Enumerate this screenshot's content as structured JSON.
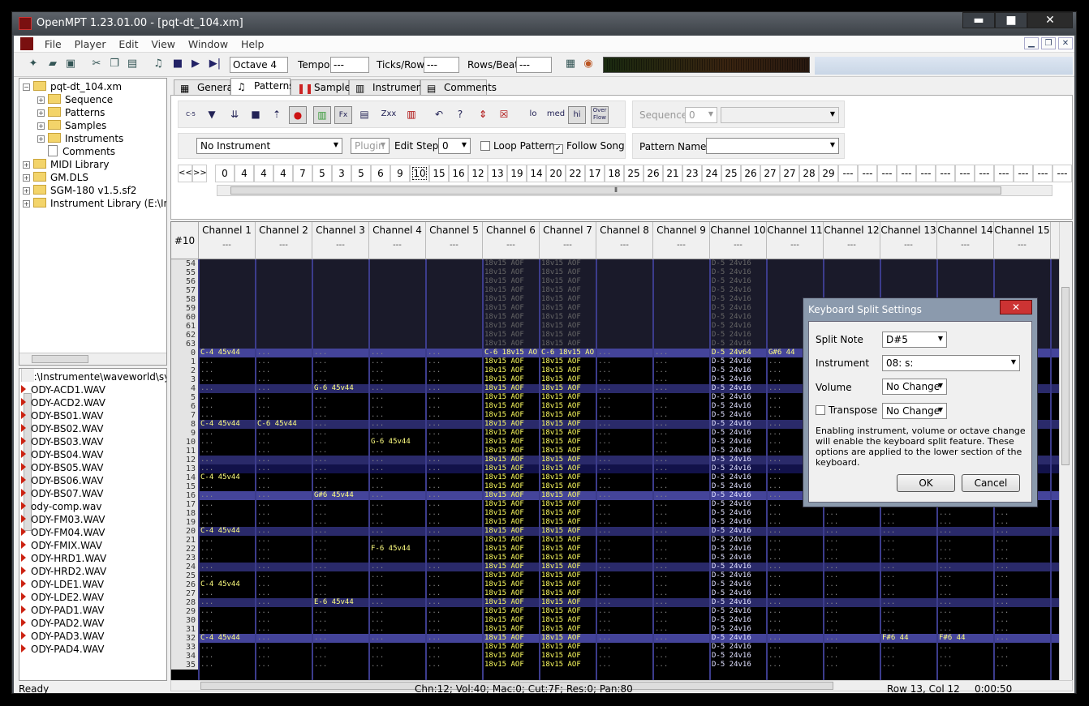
{
  "window": {
    "title": "OpenMPT 1.23.01.00 - [pqt-dt_104.xm]",
    "min": "▬",
    "max": "■",
    "close": "✕"
  },
  "menu": [
    "File",
    "Player",
    "Edit",
    "View",
    "Window",
    "Help"
  ],
  "toolbar": {
    "octave": "Octave 4",
    "tempo_label": "Tempo:",
    "tempo_val": "---",
    "ticks_label": "Ticks/Row:",
    "ticks_val": "---",
    "rpb_label": "Rows/Beat:",
    "rpb_val": "---"
  },
  "tree": {
    "root": "pqt-dt_104.xm",
    "items": [
      "Sequence",
      "Patterns",
      "Samples",
      "Instruments",
      "Comments"
    ],
    "libs": [
      "MIDI Library",
      "GM.DLS",
      "SGM-180 v1.5.sf2",
      "Instrument Library (E:\\Instrum"
    ]
  },
  "files": {
    "path": "E:\\Instrumente\\waveworld\\synth",
    "items": [
      "ODY-ACD1.WAV",
      "ODY-ACD2.WAV",
      "ODY-BS01.WAV",
      "ODY-BS02.WAV",
      "ODY-BS03.WAV",
      "ODY-BS04.WAV",
      "ODY-BS05.WAV",
      "ODY-BS06.WAV",
      "ODY-BS07.WAV",
      "ody-comp.wav",
      "ODY-FM03.WAV",
      "ODY-FM04.WAV",
      "ODY-FMIX.WAV",
      "ODY-HRD1.WAV",
      "ODY-HRD2.WAV",
      "ODY-LDE1.WAV",
      "ODY-LDE2.WAV",
      "ODY-PAD1.WAV",
      "ODY-PAD2.WAV",
      "ODY-PAD3.WAV",
      "ODY-PAD4.WAV"
    ]
  },
  "tabs": [
    "General",
    "Patterns",
    "Samples",
    "Instruments",
    "Comments"
  ],
  "patterns": {
    "instrument": "No Instrument",
    "plugin": "Plugin",
    "edit_step_label": "Edit Step",
    "edit_step": "0",
    "loop": "Loop Pattern",
    "follow": "Follow Song",
    "follow_checked": "✓",
    "seq_label": "Sequence",
    "seq_val": "0",
    "name_label": "Pattern Name",
    "lo": "lo",
    "med": "med",
    "hi": "hi",
    "overflow": "Over Flow",
    "zxx": "Zxx",
    "fx": "Fx",
    "cs": "C-5"
  },
  "orders": {
    "nav_prev": "<<",
    "nav_next": ">>",
    "list": [
      "0",
      "4",
      "4",
      "4",
      "7",
      "5",
      "3",
      "5",
      "6",
      "9",
      "10",
      "15",
      "16",
      "12",
      "13",
      "19",
      "14",
      "20",
      "22",
      "17",
      "18",
      "25",
      "26",
      "21",
      "23",
      "24",
      "25",
      "26",
      "27",
      "27",
      "28",
      "29",
      "---",
      "---",
      "---",
      "---",
      "---",
      "---",
      "---",
      "---",
      "---",
      "---",
      "---",
      "---"
    ],
    "current": "10"
  },
  "pattern_num": "#10",
  "channels": [
    "Channel 1",
    "Channel 2",
    "Channel 3",
    "Channel 4",
    "Channel 5",
    "Channel 6",
    "Channel 7",
    "Channel 8",
    "Channel 9",
    "Channel 10",
    "Channel 11",
    "Channel 12",
    "Channel 13",
    "Channel 14",
    "Channel 15"
  ],
  "channel_dash": "---",
  "rows": {
    "prev": [
      "54",
      "55",
      "56",
      "57",
      "58",
      "59",
      "60",
      "61",
      "62",
      "63"
    ],
    "cur": [
      "0",
      "1",
      "2",
      "3",
      "4",
      "5",
      "6",
      "7",
      "8",
      "9",
      "10",
      "11",
      "12",
      "13",
      "14",
      "15",
      "16",
      "17",
      "18",
      "19",
      "20",
      "21",
      "22",
      "23",
      "24",
      "25",
      "26",
      "27",
      "28",
      "29",
      "30",
      "31",
      "32",
      "33",
      "34",
      "35"
    ]
  },
  "notes": [
    {
      "r": "0",
      "c": 0,
      "t": "C-4 45v44"
    },
    {
      "r": "0",
      "c": 5,
      "t": "C-6 18v15 AOF"
    },
    {
      "r": "0",
      "c": 6,
      "t": "C-6 18v15 AOF"
    },
    {
      "r": "0",
      "c": 9,
      "t": "D-5 24v64"
    },
    {
      "r": "0",
      "c": 10,
      "t": "G#6 44 "
    },
    {
      "r": "4",
      "c": 2,
      "t": "G-6 45v44"
    },
    {
      "r": "8",
      "c": 0,
      "t": "C-4 45v44"
    },
    {
      "r": "8",
      "c": 1,
      "t": "C-6 45v44"
    },
    {
      "r": "10",
      "c": 3,
      "t": "G-6 45v44"
    },
    {
      "r": "14",
      "c": 0,
      "t": "C-4 45v44"
    },
    {
      "r": "16",
      "c": 2,
      "t": "G#6 45v44"
    },
    {
      "r": "20",
      "c": 0,
      "t": "C-4 45v44"
    },
    {
      "r": "22",
      "c": 3,
      "t": "F-6 45v44"
    },
    {
      "r": "26",
      "c": 0,
      "t": "C-4 45v44"
    },
    {
      "r": "28",
      "c": 2,
      "t": "E-6 45v44"
    },
    {
      "r": "32",
      "c": 0,
      "t": "C-4 45v44"
    },
    {
      "r": "32",
      "c": 12,
      "t": "F#6 44 "
    },
    {
      "r": "32",
      "c": 13,
      "t": "F#6 44 "
    }
  ],
  "fill_cells": {
    "c5": "18v15 AOF",
    "c6": "18v15 AOF",
    "c9": "D-5 24v16",
    "dots": "..."
  },
  "status": {
    "ready": "Ready",
    "info": "Chn:12; Vol:40; Mac:0; Cut:7F; Res:0; Pan:80",
    "pos": "Row 13, Col 12",
    "time": "0:00:50"
  },
  "dialog": {
    "title": "Keyboard Split Settings",
    "close": "✕",
    "split_note_label": "Split Note",
    "split_note": "D#5",
    "instrument_label": "Instrument",
    "instrument": "08: s:",
    "volume_label": "Volume",
    "volume": "No Change",
    "transpose_label": "Transpose",
    "transpose": "No Change",
    "note": "Enabling instrument, volume or octave change will enable the keyboard split feature. These options are applied to the lower section of the keyboard.",
    "ok": "OK",
    "cancel": "Cancel"
  }
}
